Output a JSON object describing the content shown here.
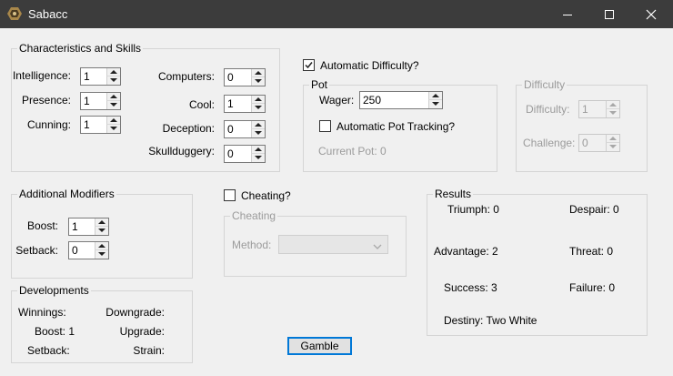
{
  "window": {
    "title": "Sabacc"
  },
  "characteristics": {
    "legend": "Characteristics and Skills",
    "intelligence": {
      "label": "Intelligence:",
      "value": "1"
    },
    "presence": {
      "label": "Presence:",
      "value": "1"
    },
    "cunning": {
      "label": "Cunning:",
      "value": "1"
    },
    "computers": {
      "label": "Computers:",
      "value": "0"
    },
    "cool": {
      "label": "Cool:",
      "value": "1"
    },
    "deception": {
      "label": "Deception:",
      "value": "0"
    },
    "skullduggery": {
      "label": "Skullduggery:",
      "value": "0"
    }
  },
  "automatic_difficulty": {
    "label": "Automatic Difficulty?",
    "checked": true
  },
  "pot": {
    "legend": "Pot",
    "wager_label": "Wager:",
    "wager_value": "250",
    "auto_tracking_label": "Automatic Pot Tracking?",
    "current_pot": "Current Pot: 0"
  },
  "difficulty": {
    "legend": "Difficulty",
    "difficulty_label": "Difficulty:",
    "difficulty_value": "1",
    "challenge_label": "Challenge:",
    "challenge_value": "0"
  },
  "modifiers": {
    "legend": "Additional Modifiers",
    "boost_label": "Boost:",
    "boost_value": "1",
    "setback_label": "Setback:",
    "setback_value": "0"
  },
  "cheating": {
    "checkbox_label": "Cheating?",
    "legend": "Cheating",
    "method_label": "Method:",
    "method_value": ""
  },
  "results": {
    "legend": "Results",
    "triumph": "Triumph: 0",
    "despair": "Despair: 0",
    "advantage": "Advantage: 2",
    "threat": "Threat: 0",
    "success": "Success: 3",
    "failure": "Failure: 0",
    "destiny": "Destiny: Two White"
  },
  "developments": {
    "legend": "Developments",
    "winnings": "Winnings:",
    "downgrade": "Downgrade:",
    "boost": "Boost: 1",
    "upgrade": "Upgrade:",
    "setback": "Setback:",
    "strain": "Strain:"
  },
  "gamble_button": "Gamble",
  "icons": {
    "app": "sabacc-app-icon",
    "minimize": "minimize-icon",
    "maximize": "maximize-icon",
    "close": "close-icon"
  }
}
